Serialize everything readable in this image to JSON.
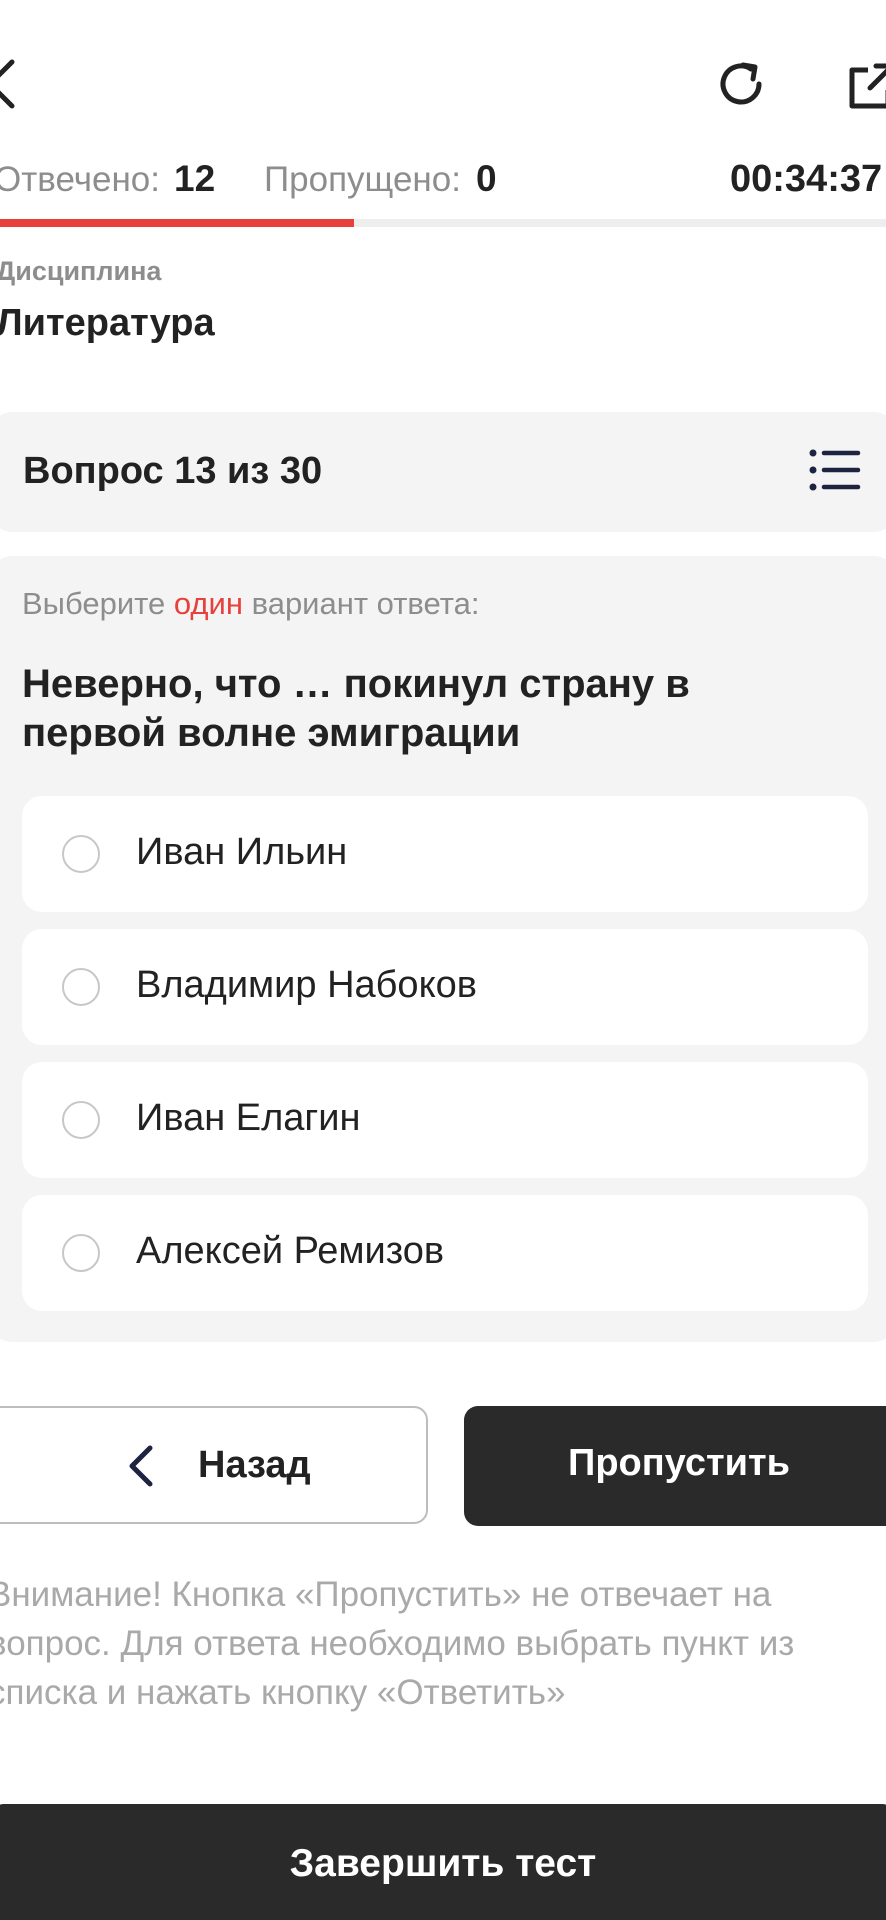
{
  "stats": {
    "answered_label": "Отвечено:",
    "answered_value": "12",
    "skipped_label": "Пропущено:",
    "skipped_value": "0",
    "timer": "00:34:37"
  },
  "progress": {
    "fraction": 0.4
  },
  "discipline": {
    "label": "Дисциплина",
    "value": "Литература"
  },
  "question": {
    "counter": "Вопрос 13 из 30",
    "instruction_before": "Выберите ",
    "instruction_accent": "один",
    "instruction_after": " вариант ответа:",
    "text": "Неверно, что … покинул страну в первой волне эмиграции",
    "options": [
      {
        "label": "Иван Ильин"
      },
      {
        "label": "Владимир Набоков"
      },
      {
        "label": "Иван Елагин"
      },
      {
        "label": "Алексей Ремизов"
      }
    ]
  },
  "buttons": {
    "back_label": "Назад",
    "skip_label": "Пропустить",
    "finish_label": "Завершить тест"
  },
  "warning": "Внимание! Кнопка «Пропустить» не отвечает на вопрос. Для ответа необходимо выбрать пункт из списка и нажать кнопку «Ответить»",
  "colors": {
    "accent": "#e8403c",
    "dark": "#2a2a2a",
    "panel": "#f4f4f4"
  }
}
